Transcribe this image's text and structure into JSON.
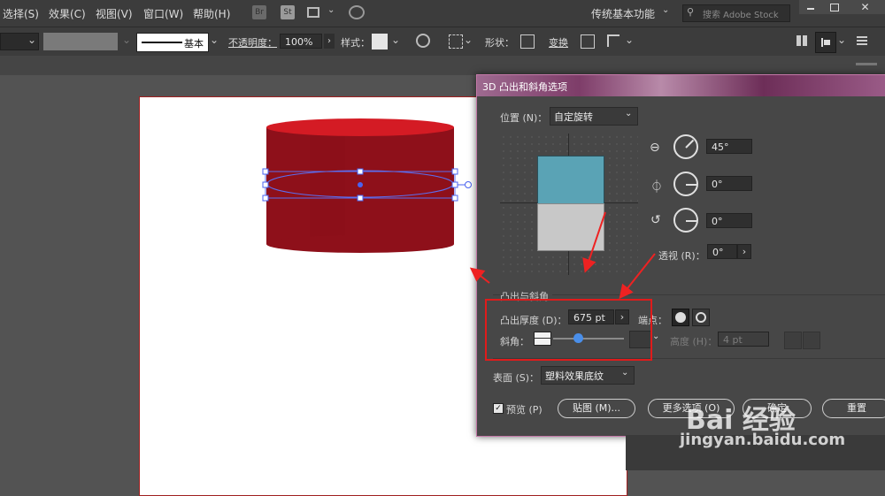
{
  "menubar": {
    "items": [
      "选择(S)",
      "效果(C)",
      "视图(V)",
      "窗口(W)",
      "帮助(H)"
    ],
    "br_icon": "Br",
    "st_icon": "St",
    "workspace": "传统基本功能",
    "search_placeholder": "搜索 Adobe Stock"
  },
  "control": {
    "stroke_profile": "基本",
    "opacity_label": "不透明度：",
    "opacity_value": "100%",
    "style_label": "样式：",
    "shape_label": "形状：",
    "transform_label": "变换"
  },
  "dialog": {
    "title": "3D 凸出和斜角选项",
    "position_label": "位置 (N)：",
    "position_value": "自定旋转",
    "rot_x": "45°",
    "rot_y": "0°",
    "rot_z": "0°",
    "perspective_label": "透视 (R)：",
    "perspective_value": "0°",
    "section_extrude": "凸出与斜角",
    "depth_label": "凸出厚度 (D)：",
    "depth_value": "675 pt",
    "cap_label": "端点：",
    "bevel_label": "斜角：",
    "height_label": "高度 (H)：",
    "height_value": "4 pt",
    "surface_label": "表面 (S)：",
    "surface_value": "塑料效果底纹",
    "preview_label": "预览 (P)",
    "map_button": "贴图 (M)...",
    "more_button": "更多选项 (O)",
    "ok_button": "确定",
    "reset_button": "重置",
    "cube_colors": {
      "front": "#5aa3b5",
      "bottom": "#c8c8c8"
    }
  },
  "watermark": {
    "logo": "Bai 经验",
    "url": "jingyan.baidu.com"
  },
  "colors": {
    "cylinder_top": "#d21a24",
    "cylinder_body": "#8c101a",
    "highlight_box": "#e01b1b"
  }
}
